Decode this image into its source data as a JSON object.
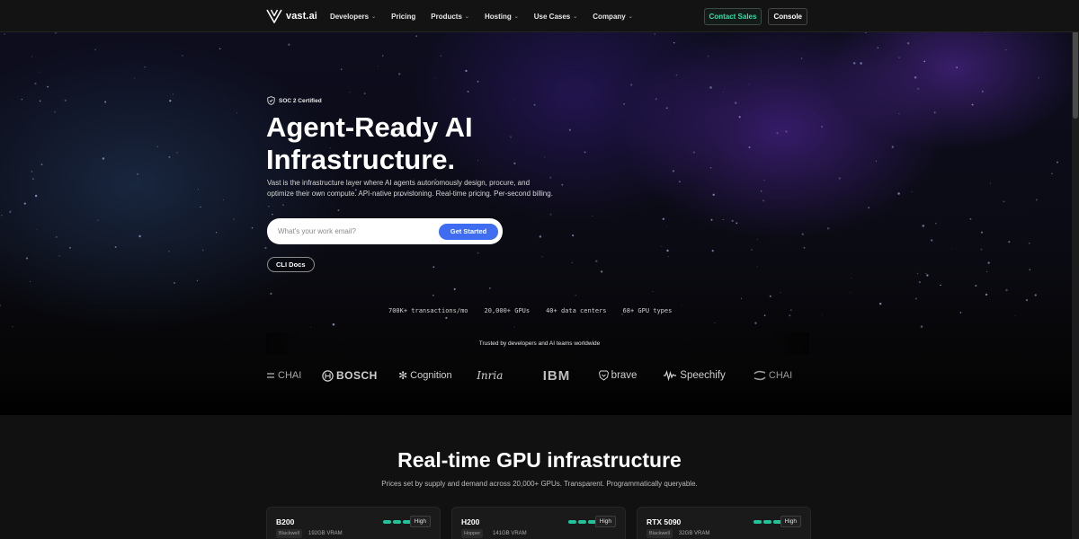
{
  "nav": {
    "brand": "vast.ai",
    "items": [
      {
        "label": "Developers",
        "has_menu": true
      },
      {
        "label": "Pricing",
        "has_menu": false
      },
      {
        "label": "Products",
        "has_menu": true
      },
      {
        "label": "Hosting",
        "has_menu": true
      },
      {
        "label": "Use Cases",
        "has_menu": true
      },
      {
        "label": "Company",
        "has_menu": true
      }
    ],
    "contact_label": "Contact Sales",
    "console_label": "Console"
  },
  "hero": {
    "badge": "SOC 2 Certified",
    "title_line1": "Agent-Ready AI",
    "title_line2": "Infrastructure.",
    "description": "Vast is the infrastructure layer where AI agents autonomously design, procure, and optimize their own compute. API-native provisioning. Real-time pricing. Per-second billing.",
    "email_placeholder": "What's your work email?",
    "cta_label": "Get Started",
    "cli_label": "CLI Docs",
    "stats": [
      "700K+ transactions/mo",
      "20,000+ GPUs",
      "40+ data centers",
      "68+ GPU types"
    ],
    "trusted": "Trusted by developers and AI teams worldwide",
    "logos": [
      "CHAI",
      "BOSCH",
      "Cognition",
      "Inria",
      "IBM",
      "brave",
      "Speechify",
      "CHAI"
    ]
  },
  "gpu_section": {
    "title": "Real-time GPU infrastructure",
    "subtitle": "Prices set by supply and demand across 20,000+ GPUs. Transparent. Programmatically queryable.",
    "cards": [
      {
        "name": "B200",
        "level": "High",
        "arch": "Blackwell",
        "vram": "192GB VRAM"
      },
      {
        "name": "H200",
        "level": "High",
        "arch": "Hopper",
        "vram": "141GB VRAM"
      },
      {
        "name": "RTX 5090",
        "level": "High",
        "arch": "Blackwell",
        "vram": "32GB VRAM"
      }
    ]
  },
  "colors": {
    "accent_green": "#2fe0a7",
    "cta_blue": "#3f6cf0",
    "meter_green": "#21c49a"
  }
}
